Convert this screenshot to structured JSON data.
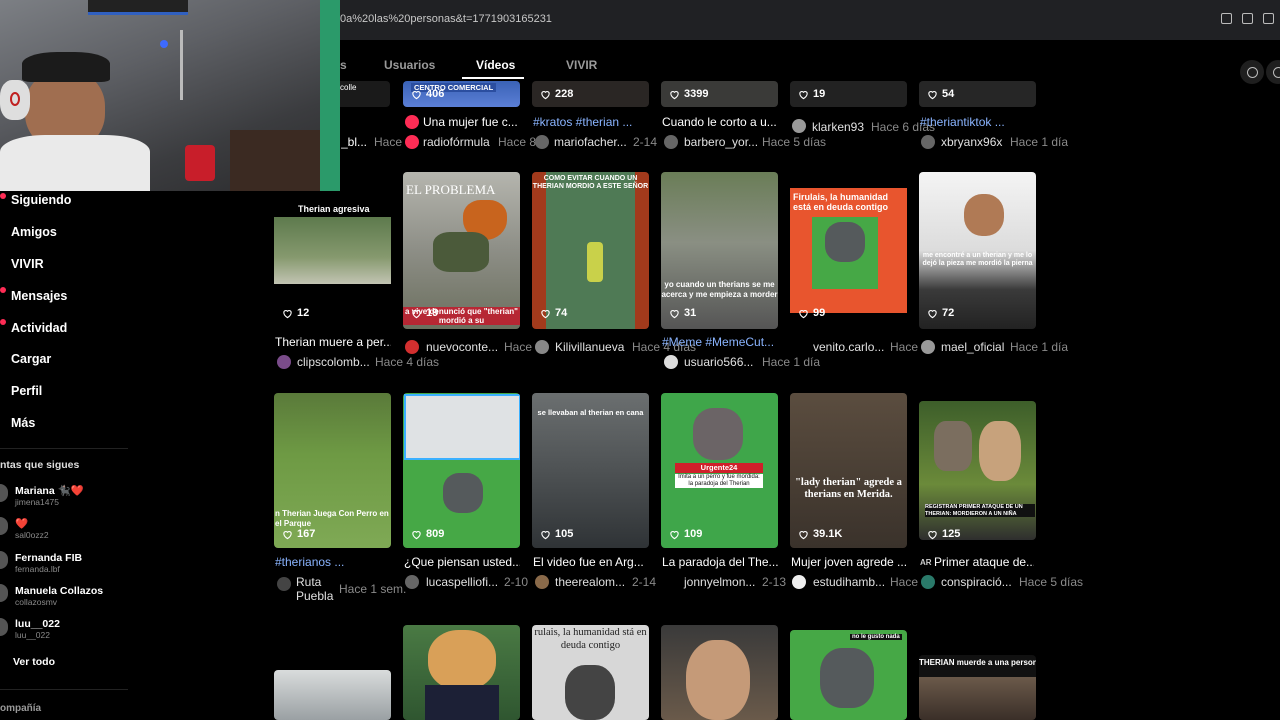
{
  "browser": {
    "url": "0a%20las%20personas&t=1771903165231"
  },
  "tabs": [
    {
      "label": "s"
    },
    {
      "label": "Usuarios"
    },
    {
      "label": "Vídeos"
    },
    {
      "label": "VIVIR"
    }
  ],
  "sidebar": {
    "nav": [
      "Siguiendo",
      "Amigos",
      "VIVIR",
      "Mensajes",
      "Actividad",
      "Cargar",
      "Perfil",
      "Más"
    ],
    "section_title": "ntas que sigues",
    "accounts": [
      {
        "name": "Mariana 🐈‍⬛❤️",
        "handle": "jimena1475"
      },
      {
        "name": "❤️",
        "handle": "sal0ozz2"
      },
      {
        "name": "Fernanda FIB",
        "handle": "fernanda.lbf"
      },
      {
        "name": "Manuela Collazos",
        "handle": "collazosmv"
      },
      {
        "name": "luu__022",
        "handle": "luu__022"
      }
    ],
    "see_all": "Ver todo",
    "bottom_section": "ompañía"
  },
  "row0": {
    "left_caption": "_bl...",
    "left_date": "Hace",
    "left_thumb_text": "colle",
    "cards": [
      {
        "likes": "406",
        "thumb_text": "CENTRO COMERCIAL",
        "caption": "Una mujer fue c...",
        "creator": "radiofórmula",
        "date": "Hace 8"
      },
      {
        "likes": "228",
        "caption": "#kratos #therian ...",
        "creator": "mariofacher...",
        "date": "2-14"
      },
      {
        "likes": "3399",
        "caption": "Cuando le corto a u...",
        "creator": "barbero_yor...",
        "date": "Hace 5 días"
      },
      {
        "likes": "19",
        "caption": "",
        "creator": "klarken93",
        "date": "Hace 6 días"
      },
      {
        "likes": "54",
        "caption": "#theriantiktok ...",
        "creator": "xbryanx96x",
        "date": "Hace 1 día"
      }
    ]
  },
  "row1": {
    "cards": [
      {
        "likes": "12",
        "top_label": "Therian agresiva",
        "caption": "Therian muere a per...",
        "creator": "clipscolomb...",
        "date": "Hace 4 días"
      },
      {
        "likes": "19",
        "thumb_text": "EL PROBLEMA",
        "bottom_text": "a vive denunció que \"therian\" mordió a su",
        "caption": "",
        "creator": "nuevoconte...",
        "date": "Hace"
      },
      {
        "likes": "74",
        "thumb_text": "COMO EVITAR CUANDO UN THERIAN MORDIO A ESTE SEÑOR",
        "caption": "",
        "creator": "Kilivillanueva",
        "date": "Hace 4 días"
      },
      {
        "likes": "31",
        "thumb_text": "yo cuando un therians se me acerca y me empieza a morder",
        "caption": "#Meme #MemeCut...",
        "creator": "usuario566...",
        "date": "Hace 1 día"
      },
      {
        "likes": "99",
        "thumb_text": "Firulais, la humanidad está en deuda contigo",
        "caption": "",
        "creator": "venito.carlo...",
        "date": "Hace"
      },
      {
        "likes": "72",
        "thumb_text": "me encontré a un therian y me lo dejó la pieza me mordió la pierna",
        "caption": "",
        "creator": "mael_oficial",
        "date": "Hace 1 día"
      }
    ]
  },
  "row2": {
    "cards": [
      {
        "likes": "167",
        "bottom_text": "n Therian Juega Con Perro en el Parque",
        "caption": "#therianos ...",
        "creator": "Ruta Puebla",
        "date": "Hace 1 sem."
      },
      {
        "likes": "809",
        "caption": "¿Que piensan usted...",
        "creator": "lucaspelliofi...",
        "date": "2-10"
      },
      {
        "likes": "105",
        "thumb_text": "se llevaban al therian en cana",
        "caption": "El video fue en Arg...",
        "creator": "theerealom...",
        "date": "2-14"
      },
      {
        "likes": "109",
        "thumb_text": "Urgente24",
        "sub_text": "Imita a un perro y fue mordida: la paradoja del Therian",
        "caption": "La paradoja del The...",
        "creator": "jonnyelmon...",
        "date": "2-13"
      },
      {
        "likes": "39.1K",
        "thumb_text": "\"lady therian\" agrede a therians en Merida.",
        "caption": "Mujer joven agrede ...",
        "creator": "estudihamb...",
        "date": "Hace"
      },
      {
        "likes": "125",
        "thumb_text": "REGISTRAN PRIMER ATAQUE DE UN THERIAN: MORDIERON A UN NIÑA",
        "caption": "Primer ataque de...",
        "prefix": "AR",
        "creator": "conspiració...",
        "date": "Hace 5 días"
      }
    ]
  },
  "row3": {
    "cards": [
      {
        "thumb_text": ""
      },
      {
        "thumb_text": ""
      },
      {
        "thumb_text": "rulais, la humanidad stá en deuda contigo"
      },
      {
        "thumb_text": ""
      },
      {
        "thumb_text": "no le gusto nada"
      },
      {
        "thumb_text": "THERIAN muerde a una persona"
      }
    ]
  },
  "colors": {
    "accent": "#fe2c55",
    "link": "#8ab4ff",
    "background": "#000000"
  }
}
